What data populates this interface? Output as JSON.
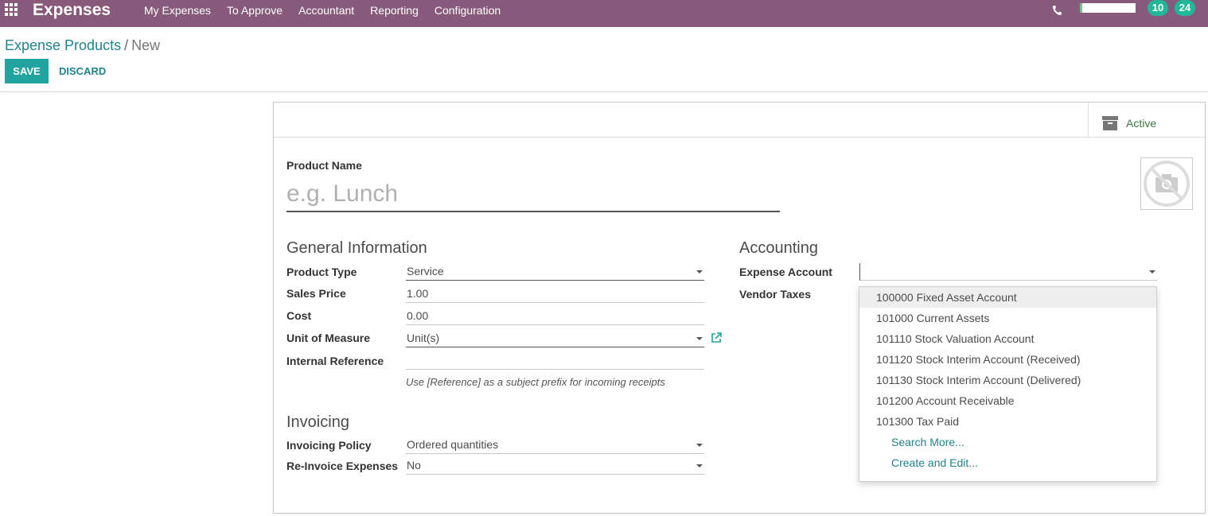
{
  "navbar": {
    "app_title": "Expenses",
    "menu": [
      "My Expenses",
      "To Approve",
      "Accountant",
      "Reporting",
      "Configuration"
    ],
    "badges": [
      "10",
      "24"
    ],
    "icons": [
      "apps-grid-icon",
      "phone-icon"
    ],
    "color": "#875a7b"
  },
  "breadcrumb": {
    "parent": "Expense Products",
    "separator": "/",
    "current": "New"
  },
  "buttons": {
    "save": "SAVE",
    "discard": "DISCARD"
  },
  "sheet": {
    "active_label": "Active",
    "product_name_label": "Product Name",
    "product_name_placeholder": "e.g. Lunch",
    "general": {
      "heading": "General Information",
      "product_type_label": "Product Type",
      "product_type_value": "Service",
      "sales_price_label": "Sales Price",
      "sales_price_value": "1.00",
      "cost_label": "Cost",
      "cost_value": "0.00",
      "uom_label": "Unit of Measure",
      "uom_value": "Unit(s)",
      "internal_ref_label": "Internal Reference",
      "internal_ref_value": "",
      "internal_ref_hint": "Use [Reference] as a subject prefix for incoming receipts"
    },
    "invoicing": {
      "heading": "Invoicing",
      "policy_label": "Invoicing Policy",
      "policy_value": "Ordered quantities",
      "reinvoice_label": "Re-Invoice Expenses",
      "reinvoice_value": "No"
    },
    "accounting": {
      "heading": "Accounting",
      "expense_account_label": "Expense Account",
      "expense_account_value": "",
      "vendor_taxes_label": "Vendor Taxes"
    }
  },
  "dropdown": {
    "items": [
      "100000 Fixed Asset Account",
      "101000 Current Assets",
      "101110 Stock Valuation Account",
      "101120 Stock Interim Account (Received)",
      "101130 Stock Interim Account (Delivered)",
      "101200 Account Receivable",
      "101300 Tax Paid"
    ],
    "search_more": "Search More...",
    "create_edit": "Create and Edit..."
  },
  "colors": {
    "accent": "#21a3a0",
    "link": "#21838d",
    "badge": "#21b799"
  }
}
